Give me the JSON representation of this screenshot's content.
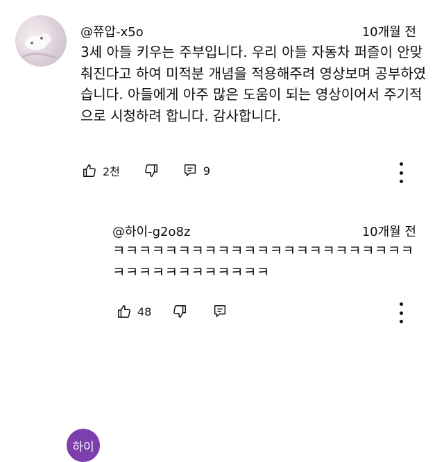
{
  "comments": [
    {
      "handle": "@쮸압-x5o",
      "time": "10개월 전",
      "text": "3세 아들 키우는 주부입니다. 우리 아들 자동차 퍼즐이 안맞춰진다고 하여 미적분 개념을 적용해주려 영상보며 공부하였습니다. 아들에게 아주 많은 도움이 되는 영상이어서 주기적으로 시청하려 합니다. 감사합니다.",
      "likes": "2천",
      "replies": "9"
    },
    {
      "avatar_text": "하이",
      "avatar_color": "#7e3fae",
      "handle": "@하이-g2o8z",
      "time": "10개월 전",
      "text": "ㅋㅋㅋㅋㅋㅋㅋㅋㅋㅋㅋㅋㅋㅋㅋㅋㅋㅋㅋㅋㅋㅋㅋㅋㅋㅋㅋㅋㅋㅋㅋㅋㅋㅋㅋ",
      "likes": "48"
    }
  ]
}
